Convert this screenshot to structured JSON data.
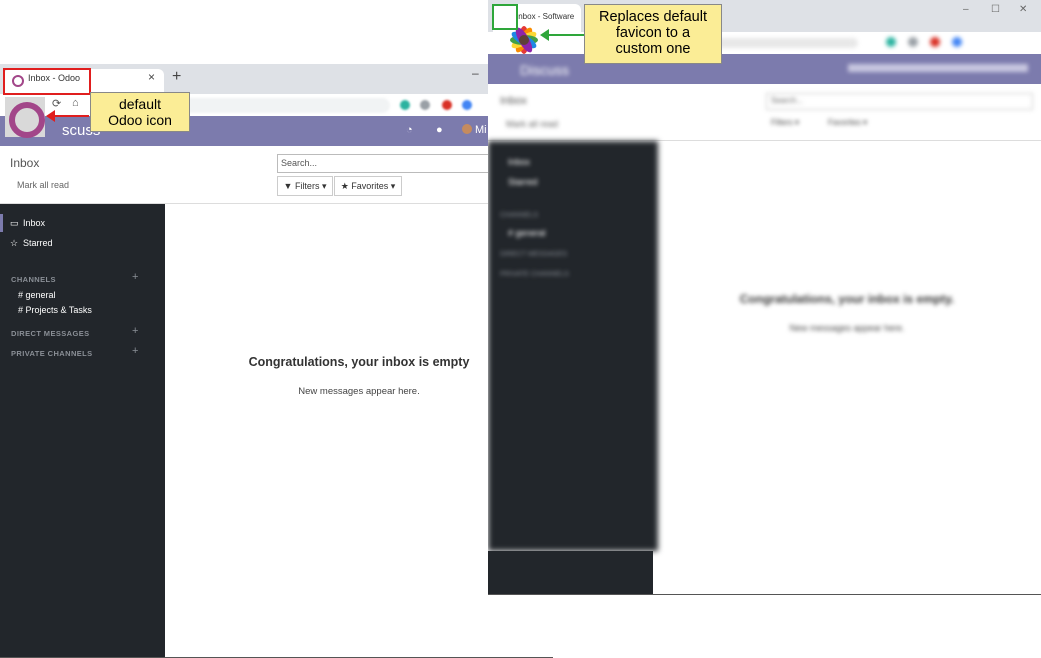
{
  "left": {
    "tab_title": "Inbox - Odoo",
    "tab_close": "×",
    "new_tab": "+",
    "minimize": "–",
    "nav_title": "scuss",
    "nav_user": "Mi",
    "breadcrumb": "Inbox",
    "mark_all_read": "Mark all read",
    "search_placeholder": "Search...",
    "filters_label": "▼ Filters ▾",
    "favorites_label": "★ Favorites ▾",
    "sidebar": {
      "inbox": "Inbox",
      "starred": "Starred",
      "channels_header": "CHANNELS",
      "channels": [
        "# general",
        "# Projects & Tasks"
      ],
      "direct_header": "DIRECT MESSAGES",
      "private_header": "PRIVATE CHANNELS",
      "plus": "+"
    },
    "empty_title": "Congratulations, your inbox is empty",
    "empty_sub": "New messages appear here.",
    "callout": "default\nOdoo icon",
    "accent_color": "#7c7bad"
  },
  "right": {
    "tab_title": "Inbox - Software",
    "window_controls": [
      "–",
      "☐",
      "✕"
    ],
    "nav_title": "Discuss",
    "breadcrumb": "Inbox",
    "mark_all_read": "Mark all read",
    "search_placeholder": "Search...",
    "filters_label": "Filters ▾",
    "favorites_label": "Favorites ▾",
    "sidebar": {
      "inbox": "Inbox",
      "starred": "Starred",
      "channels_header": "CHANNELS",
      "channels": [
        "# general"
      ],
      "direct_header": "DIRECT MESSAGES",
      "private_header": "PRIVATE CHANNELS"
    },
    "empty_title": "Congratulations, your inbox is empty.",
    "empty_sub": "New messages appear here.",
    "callout": "Replaces default\nfavicon to a\ncustom one"
  }
}
